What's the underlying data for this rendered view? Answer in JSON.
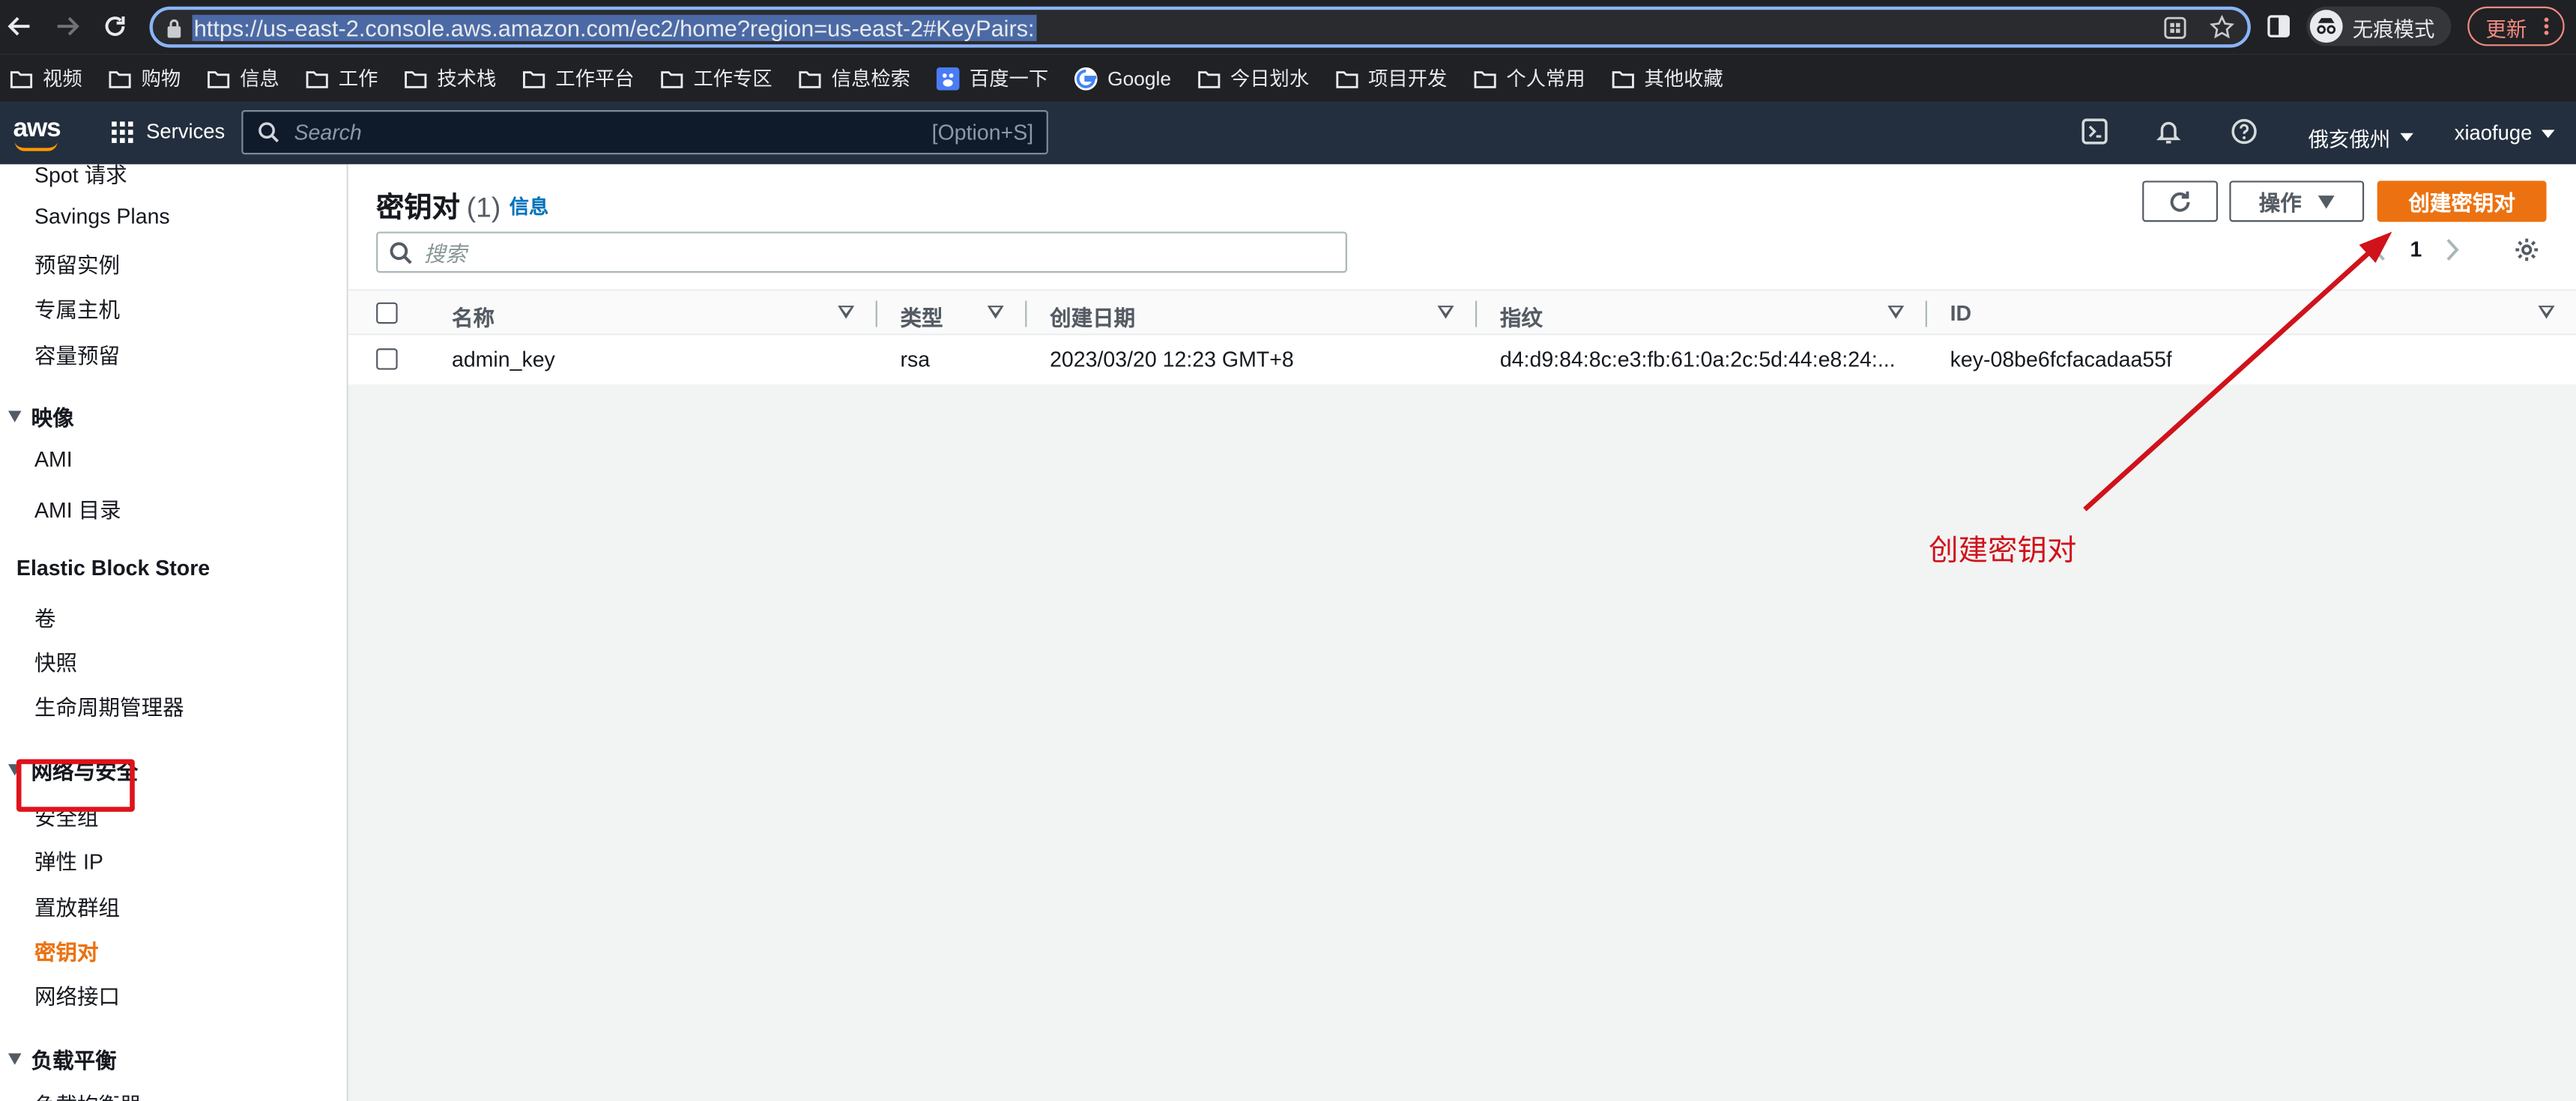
{
  "browser": {
    "url": "https://us-east-2.console.aws.amazon.com/ec2/home?region=us-east-2#KeyPairs:",
    "incognito_label": "无痕模式",
    "update_label": "更新"
  },
  "bookmarks": [
    {
      "label": "视频",
      "icon": "folder-icon"
    },
    {
      "label": "购物",
      "icon": "folder-icon"
    },
    {
      "label": "信息",
      "icon": "folder-icon"
    },
    {
      "label": "工作",
      "icon": "folder-icon"
    },
    {
      "label": "技术栈",
      "icon": "folder-icon"
    },
    {
      "label": "工作平台",
      "icon": "folder-icon"
    },
    {
      "label": "工作专区",
      "icon": "folder-icon"
    },
    {
      "label": "信息检索",
      "icon": "folder-icon"
    },
    {
      "label": "百度一下",
      "icon": "baidu-icon"
    },
    {
      "label": "Google",
      "icon": "google-icon"
    },
    {
      "label": "今日划水",
      "icon": "folder-icon"
    },
    {
      "label": "项目开发",
      "icon": "folder-icon"
    },
    {
      "label": "个人常用",
      "icon": "folder-icon"
    },
    {
      "label": "其他收藏",
      "icon": "folder-icon"
    }
  ],
  "aws": {
    "logo": "aws",
    "services_label": "Services",
    "search_placeholder": "Search",
    "search_shortcut": "[Option+S]",
    "region_label": "俄亥俄州",
    "account_label": "xiaofuge"
  },
  "sidebar": {
    "items_top": [
      "Spot 请求",
      "Savings Plans",
      "预留实例",
      "专属主机",
      "容量预留"
    ],
    "section_images": "映像",
    "items_images": [
      "AMI",
      "AMI 目录"
    ],
    "section_ebs": "Elastic Block Store",
    "items_ebs": [
      "卷",
      "快照",
      "生命周期管理器"
    ],
    "section_network": "网络与安全",
    "items_network": [
      "安全组",
      "弹性 IP",
      "置放群组",
      "密钥对",
      "网络接口"
    ],
    "section_lb": "负载平衡",
    "items_lb": [
      "负载均衡器"
    ]
  },
  "main": {
    "title": "密钥对",
    "count": "(1)",
    "info_link": "信息",
    "actions_label": "操作",
    "create_label": "创建密钥对",
    "filter_placeholder": "搜索",
    "page_number": "1",
    "columns": [
      "名称",
      "类型",
      "创建日期",
      "指纹",
      "ID"
    ],
    "rows": [
      {
        "name": "admin_key",
        "type": "rsa",
        "created": "2023/03/20 12:23 GMT+8",
        "fingerprint": "d4:d9:84:8c:e3:fb:61:0a:2c:5d:44:e8:24:...",
        "id": "key-08be6fcfacadaa55f"
      }
    ]
  },
  "annotation": {
    "label": "创建密钥对",
    "color": "#d0121b"
  },
  "colors": {
    "aws_header": "#232f3e",
    "primary": "#ec7211",
    "link": "#0073bb",
    "highlight": "#e0121b"
  }
}
